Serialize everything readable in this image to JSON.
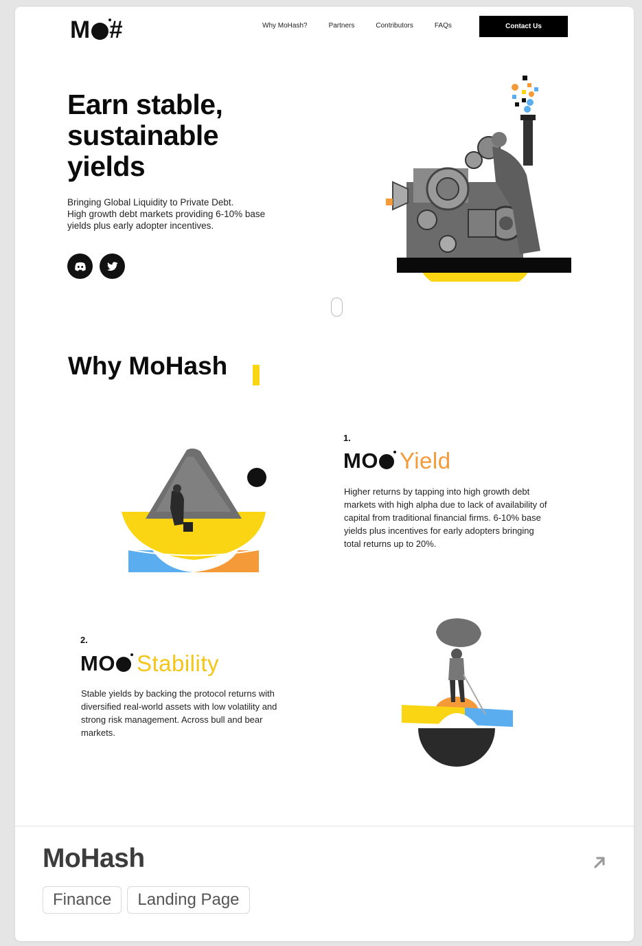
{
  "site": {
    "logo_text": "MO#",
    "nav": [
      "Why MoHash?",
      "Partners",
      "Contributors",
      "FAQs"
    ],
    "contact_label": "Contact Us"
  },
  "hero": {
    "title_lines": [
      "Earn stable,",
      "sustainable",
      "yields"
    ],
    "subtitle_lines": [
      "Bringing Global Liquidity to Private Debt.",
      "High growth debt markets providing 6-10% base",
      "yields plus early adopter incentives."
    ],
    "social_icons": [
      "discord-icon",
      "twitter-icon"
    ]
  },
  "why": {
    "title": "Why MoHash",
    "features": [
      {
        "number": "1.",
        "mo": "MO",
        "name": "Yield",
        "name_color": "#f59a38",
        "desc_lines": [
          "Higher returns by tapping into high growth debt",
          "markets with high alpha due to lack of availability of",
          "capital from traditional financial firms. 6-10% base",
          "yields plus incentives for early adopters bringing",
          "total returns up to 20%."
        ]
      },
      {
        "number": "2.",
        "mo": "MO",
        "name": "Stability",
        "name_color": "#f5c518",
        "desc_lines": [
          "Stable yields by backing the protocol returns with",
          "diversified real-world assets with low volatility and",
          "strong risk management. Across bull and bear",
          "markets."
        ]
      }
    ]
  },
  "card": {
    "title": "MoHash",
    "tags": [
      "Finance",
      "Landing Page"
    ]
  },
  "colors": {
    "accent_yellow": "#f9d513",
    "accent_orange": "#f59a38",
    "accent_blue": "#5aaef0",
    "black": "#111111"
  }
}
